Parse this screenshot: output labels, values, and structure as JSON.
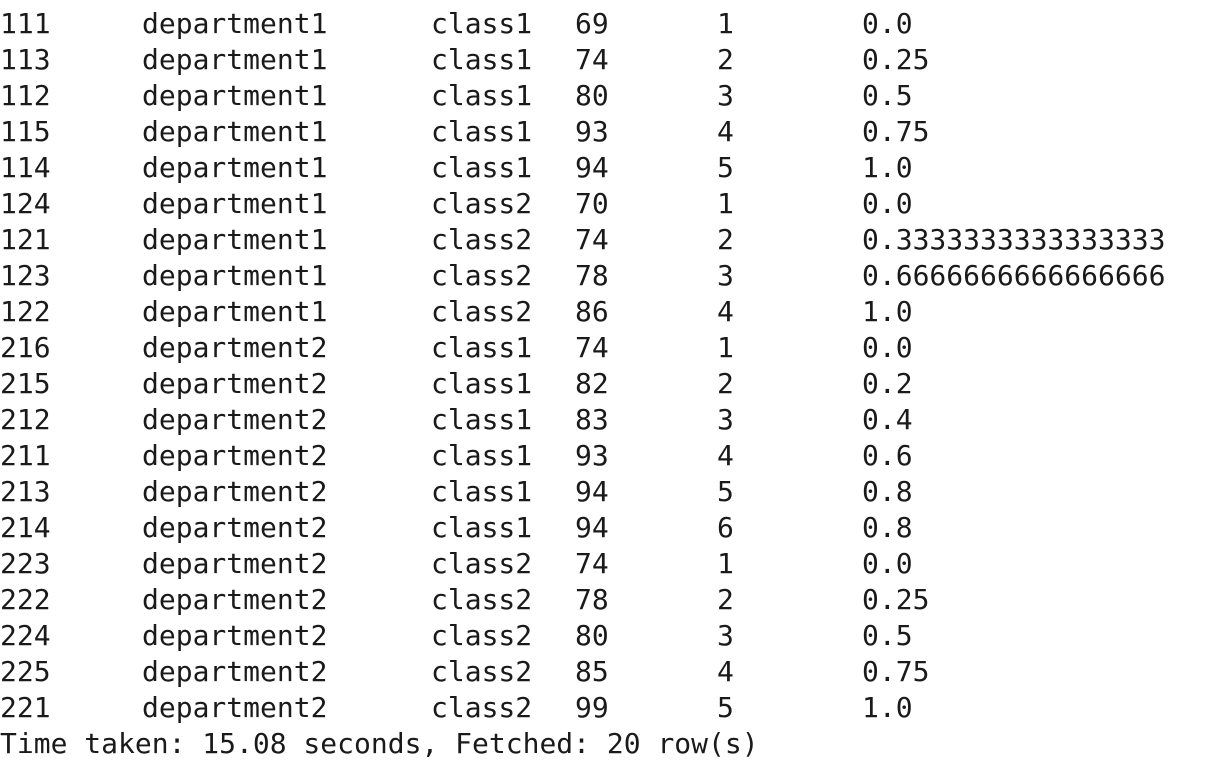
{
  "rows": [
    [
      "111",
      "department1",
      "class1",
      "69",
      "1",
      "0.0"
    ],
    [
      "113",
      "department1",
      "class1",
      "74",
      "2",
      "0.25"
    ],
    [
      "112",
      "department1",
      "class1",
      "80",
      "3",
      "0.5"
    ],
    [
      "115",
      "department1",
      "class1",
      "93",
      "4",
      "0.75"
    ],
    [
      "114",
      "department1",
      "class1",
      "94",
      "5",
      "1.0"
    ],
    [
      "124",
      "department1",
      "class2",
      "70",
      "1",
      "0.0"
    ],
    [
      "121",
      "department1",
      "class2",
      "74",
      "2",
      "0.3333333333333333"
    ],
    [
      "123",
      "department1",
      "class2",
      "78",
      "3",
      "0.6666666666666666"
    ],
    [
      "122",
      "department1",
      "class2",
      "86",
      "4",
      "1.0"
    ],
    [
      "216",
      "department2",
      "class1",
      "74",
      "1",
      "0.0"
    ],
    [
      "215",
      "department2",
      "class1",
      "82",
      "2",
      "0.2"
    ],
    [
      "212",
      "department2",
      "class1",
      "83",
      "3",
      "0.4"
    ],
    [
      "211",
      "department2",
      "class1",
      "93",
      "4",
      "0.6"
    ],
    [
      "213",
      "department2",
      "class1",
      "94",
      "5",
      "0.8"
    ],
    [
      "214",
      "department2",
      "class1",
      "94",
      "6",
      "0.8"
    ],
    [
      "223",
      "department2",
      "class2",
      "74",
      "1",
      "0.0"
    ],
    [
      "222",
      "department2",
      "class2",
      "78",
      "2",
      "0.25"
    ],
    [
      "224",
      "department2",
      "class2",
      "80",
      "3",
      "0.5"
    ],
    [
      "225",
      "department2",
      "class2",
      "85",
      "4",
      "0.75"
    ],
    [
      "221",
      "department2",
      "class2",
      "99",
      "5",
      "1.0"
    ]
  ],
  "status_line": "Time taken: 15.08 seconds, Fetched: 20 row(s)"
}
